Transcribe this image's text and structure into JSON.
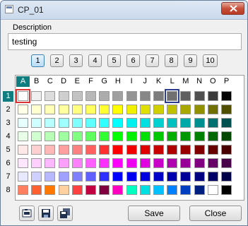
{
  "window": {
    "title": "CP_01"
  },
  "description": {
    "label": "Description",
    "value": "testing"
  },
  "pages": [
    "1",
    "2",
    "3",
    "4",
    "5",
    "6",
    "7",
    "8",
    "9",
    "10"
  ],
  "active_page_index": 0,
  "grid": {
    "columns": [
      "A",
      "B",
      "C",
      "D",
      "E",
      "F",
      "G",
      "H",
      "I",
      "J",
      "K",
      "L",
      "M",
      "N",
      "O",
      "P"
    ],
    "rows": [
      "1",
      "2",
      "3",
      "4",
      "5",
      "6",
      "7",
      "8"
    ],
    "active_column_index": 0,
    "active_row_index": 0,
    "colors": [
      [
        "#ffffff",
        "#eeeeee",
        "#dddddd",
        "#cfcfcf",
        "#c3c3c3",
        "#b8b8b8",
        "#acacac",
        "#a0a0a0",
        "#949494",
        "#888888",
        "#7c7c7c",
        "#707070",
        "#606060",
        "#505050",
        "#3c3c3c",
        "#000000"
      ],
      [
        "#ffffe8",
        "#ffffd0",
        "#ffffb8",
        "#ffffa0",
        "#ffff80",
        "#ffff60",
        "#ffff30",
        "#ffff00",
        "#f0f000",
        "#e0e000",
        "#d0d000",
        "#c0c000",
        "#a8a800",
        "#909000",
        "#707000",
        "#505000"
      ],
      [
        "#e8ffff",
        "#d0ffff",
        "#b8ffff",
        "#a0ffff",
        "#80ffff",
        "#60ffff",
        "#30ffff",
        "#00ffff",
        "#00f0f0",
        "#00e0e0",
        "#00d0d0",
        "#00c0c0",
        "#00a8a8",
        "#009090",
        "#007070",
        "#005050"
      ],
      [
        "#e8ffe8",
        "#d0ffd0",
        "#b8ffb8",
        "#a0ffa0",
        "#80ff80",
        "#60ff60",
        "#30ff30",
        "#00ff00",
        "#00f000",
        "#00e000",
        "#00c800",
        "#00b000",
        "#009800",
        "#008000",
        "#006800",
        "#004800"
      ],
      [
        "#ffe8e8",
        "#ffd0d0",
        "#ffb8b8",
        "#ffa0a0",
        "#ff8080",
        "#ff6060",
        "#ff3030",
        "#ff0000",
        "#f00000",
        "#e00000",
        "#c80000",
        "#b00000",
        "#980000",
        "#800000",
        "#680000",
        "#480000"
      ],
      [
        "#ffe8ff",
        "#ffd0ff",
        "#ffb8ff",
        "#ffa0ff",
        "#ff80ff",
        "#ff60ff",
        "#ff30ff",
        "#ff00ff",
        "#f000f0",
        "#e000e0",
        "#c800c8",
        "#b000b0",
        "#980098",
        "#800080",
        "#680068",
        "#480048"
      ],
      [
        "#e8e8ff",
        "#d0d0ff",
        "#b8b8ff",
        "#a0a0ff",
        "#8080ff",
        "#6060ff",
        "#3030ff",
        "#0000ff",
        "#0000f0",
        "#0000e0",
        "#0000c8",
        "#0000b0",
        "#000098",
        "#000080",
        "#000068",
        "#000048"
      ],
      [
        "#ff8060",
        "#ff6030",
        "#ff7800",
        "#ffd0a0",
        "#ff4040",
        "#c00040",
        "#800040",
        "#ff00c0",
        "#00ffc0",
        "#00e0e0",
        "#00c0ff",
        "#0080ff",
        "#0040c0",
        "#002080",
        "#ffffff",
        "#000000"
      ]
    ],
    "selected_cells": [
      {
        "row": 0,
        "col": 0,
        "style": "red"
      },
      {
        "row": 0,
        "col": 11,
        "style": "blue"
      }
    ]
  },
  "buttons": {
    "save": "Save",
    "close": "Close"
  },
  "icons": {
    "open": "open-palette-icon",
    "save": "save-icon",
    "save_as": "save-as-icon",
    "close": "close-icon",
    "app": "palette-window-icon"
  }
}
